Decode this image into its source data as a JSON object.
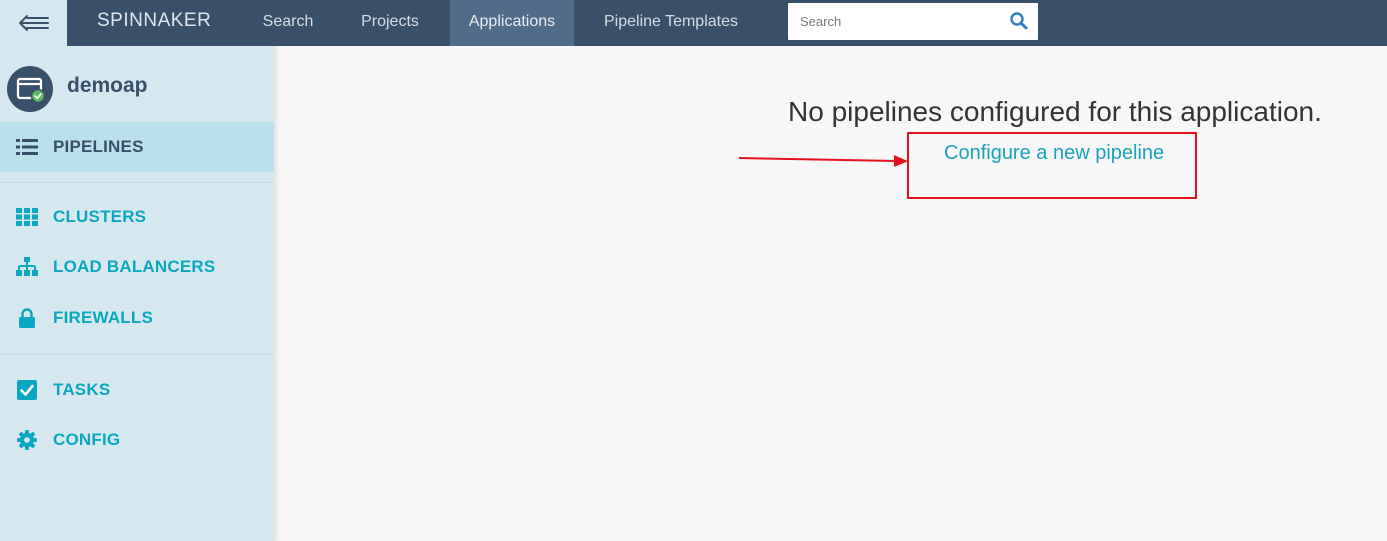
{
  "topbar": {
    "brand": "SPINNAKER",
    "nav": [
      {
        "label": "Search",
        "active": false
      },
      {
        "label": "Projects",
        "active": false
      },
      {
        "label": "Applications",
        "active": true
      },
      {
        "label": "Pipeline Templates",
        "active": false
      }
    ],
    "search": {
      "placeholder": "Search",
      "value": ""
    }
  },
  "sidebar": {
    "app_name": "demoap",
    "items": [
      {
        "label": "PIPELINES",
        "icon": "list-icon",
        "active": true
      },
      {
        "label": "CLUSTERS",
        "icon": "grid-icon",
        "active": false
      },
      {
        "label": "LOAD BALANCERS",
        "icon": "sitemap-icon",
        "active": false
      },
      {
        "label": "FIREWALLS",
        "icon": "lock-icon",
        "active": false
      },
      {
        "label": "TASKS",
        "icon": "checkbox-icon",
        "active": false
      },
      {
        "label": "CONFIG",
        "icon": "gear-icon",
        "active": false
      }
    ]
  },
  "main": {
    "empty_message": "No pipelines configured for this application.",
    "configure_link": "Configure a new pipeline"
  },
  "colors": {
    "topbar": "#39506b",
    "nav_active": "#4f6c8a",
    "sidebar": "#d6e8ef",
    "sidebar_active": "#b8e1ec",
    "accent": "#0aa7c0",
    "annotation_red": "#e3101e"
  }
}
